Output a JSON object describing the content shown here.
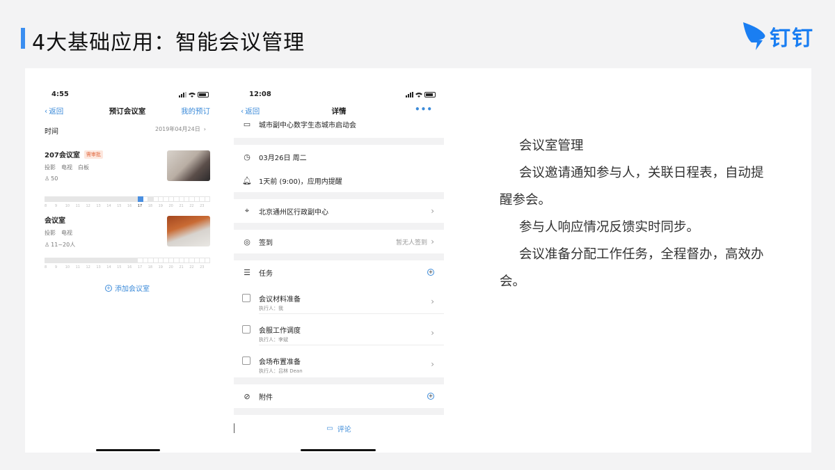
{
  "slide": {
    "title": "4大基础应用：智能会议管理",
    "brand": "钉钉",
    "accent_color": "#3b8ef0",
    "brand_color": "#1a7ef2"
  },
  "phone1": {
    "status_time": "4:55",
    "nav_back": "返回",
    "nav_title": "预订会议室",
    "nav_right": "我的预订",
    "time_label": "时间",
    "time_value": "2019年04月24日",
    "rooms": [
      {
        "name": "207会议室",
        "badge": "需审批",
        "equipment": [
          "投影",
          "电视",
          "白板"
        ],
        "capacity": "50",
        "hours": [
          "8",
          "9",
          "10",
          "11",
          "12",
          "13",
          "14",
          "15",
          "16",
          "17",
          "18",
          "19",
          "20",
          "21",
          "22",
          "23"
        ]
      },
      {
        "name": "会议室",
        "equipment": [
          "投影",
          "电视"
        ],
        "capacity": "11~20人",
        "hours": [
          "8",
          "9",
          "10",
          "11",
          "12",
          "13",
          "14",
          "15",
          "16",
          "17",
          "18",
          "19",
          "20",
          "21",
          "22",
          "23"
        ]
      }
    ],
    "add_room": "添加会议室"
  },
  "phone2": {
    "status_time": "12:08",
    "nav_back": "返回",
    "nav_title": "详情",
    "nav_right": "•••",
    "meeting_title": "城市副中心数字生态城市启动会",
    "date": "03月26日 周二",
    "reminder": "1天前 (9:00)，应用内提醒",
    "location": "北京通州区行政副中心",
    "checkin_label": "签到",
    "checkin_status": "暂无人签到",
    "tasks_label": "任务",
    "tasks": [
      {
        "name": "会议材料准备",
        "owner": "执行人：我"
      },
      {
        "name": "会服工作调度",
        "owner": "执行人：李斌"
      },
      {
        "name": "会场布置准备",
        "owner": "执行人：吕林 Dean"
      }
    ],
    "attachment_label": "附件",
    "comment_label": "评论"
  },
  "description": {
    "heading": "会议室管理",
    "paragraphs": [
      "会议邀请通知参与人，关联日程表，自动提醒参会。",
      "参与人响应情况反馈实时同步。",
      "会议准备分配工作任务，全程督办，高效办会。"
    ]
  }
}
